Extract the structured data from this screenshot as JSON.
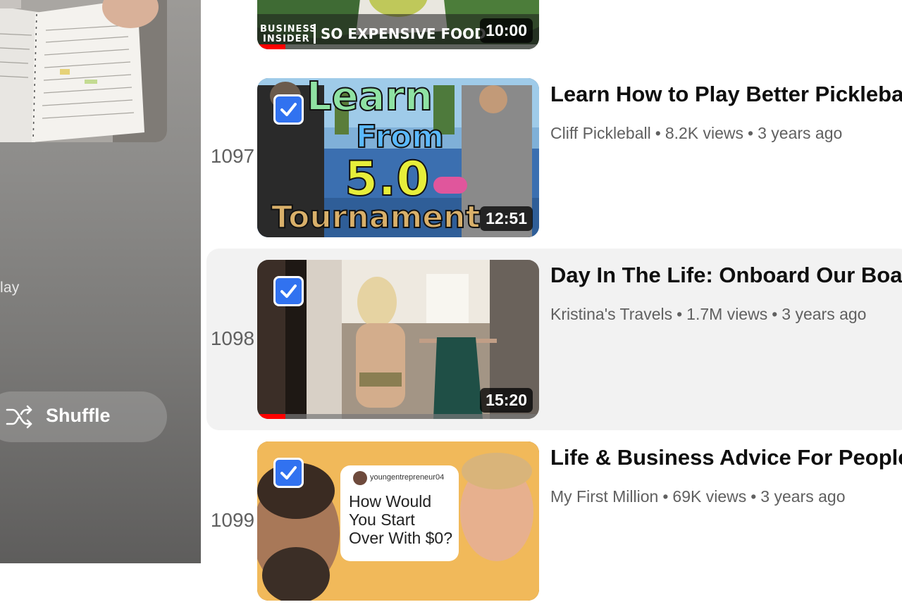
{
  "sidebar": {
    "partial_label": "lay",
    "shuffle_label": "Shuffle"
  },
  "videos": [
    {
      "duration": "10:00",
      "thumb_text": [
        "BUSINESS",
        "INSIDER",
        "SO EXPENSIVE FOOD"
      ],
      "progress": 0.1
    },
    {
      "index": "1097",
      "title": "Learn How to Play Better Pickleball",
      "channel": "Cliff Pickleball",
      "views": "8.2K views",
      "age": "3 years ago",
      "duration": "12:51",
      "thumb_text": [
        "Learn",
        "From",
        "5.0",
        "Tournament"
      ]
    },
    {
      "index": "1098",
      "title": "Day In The Life: Onboard Our Boat i",
      "channel": "Kristina's Travels",
      "views": "1.7M views",
      "age": "3 years ago",
      "duration": "15:20",
      "progress": 0.1
    },
    {
      "index": "1099",
      "title": "Life & Business Advice For People I",
      "channel": "My First Million",
      "views": "69K views",
      "age": "3 years ago",
      "thumb_text": [
        "youngentrepreneur04",
        "How Would",
        "You Start",
        "Over With $0?"
      ]
    }
  ],
  "colors": {
    "check_blue": "#3172f0",
    "progress_red": "#ff0000",
    "highlight_row": "#f2f2f2"
  },
  "icons": {
    "shuffle": "shuffle-icon",
    "check": "checkbox-checked-icon"
  }
}
